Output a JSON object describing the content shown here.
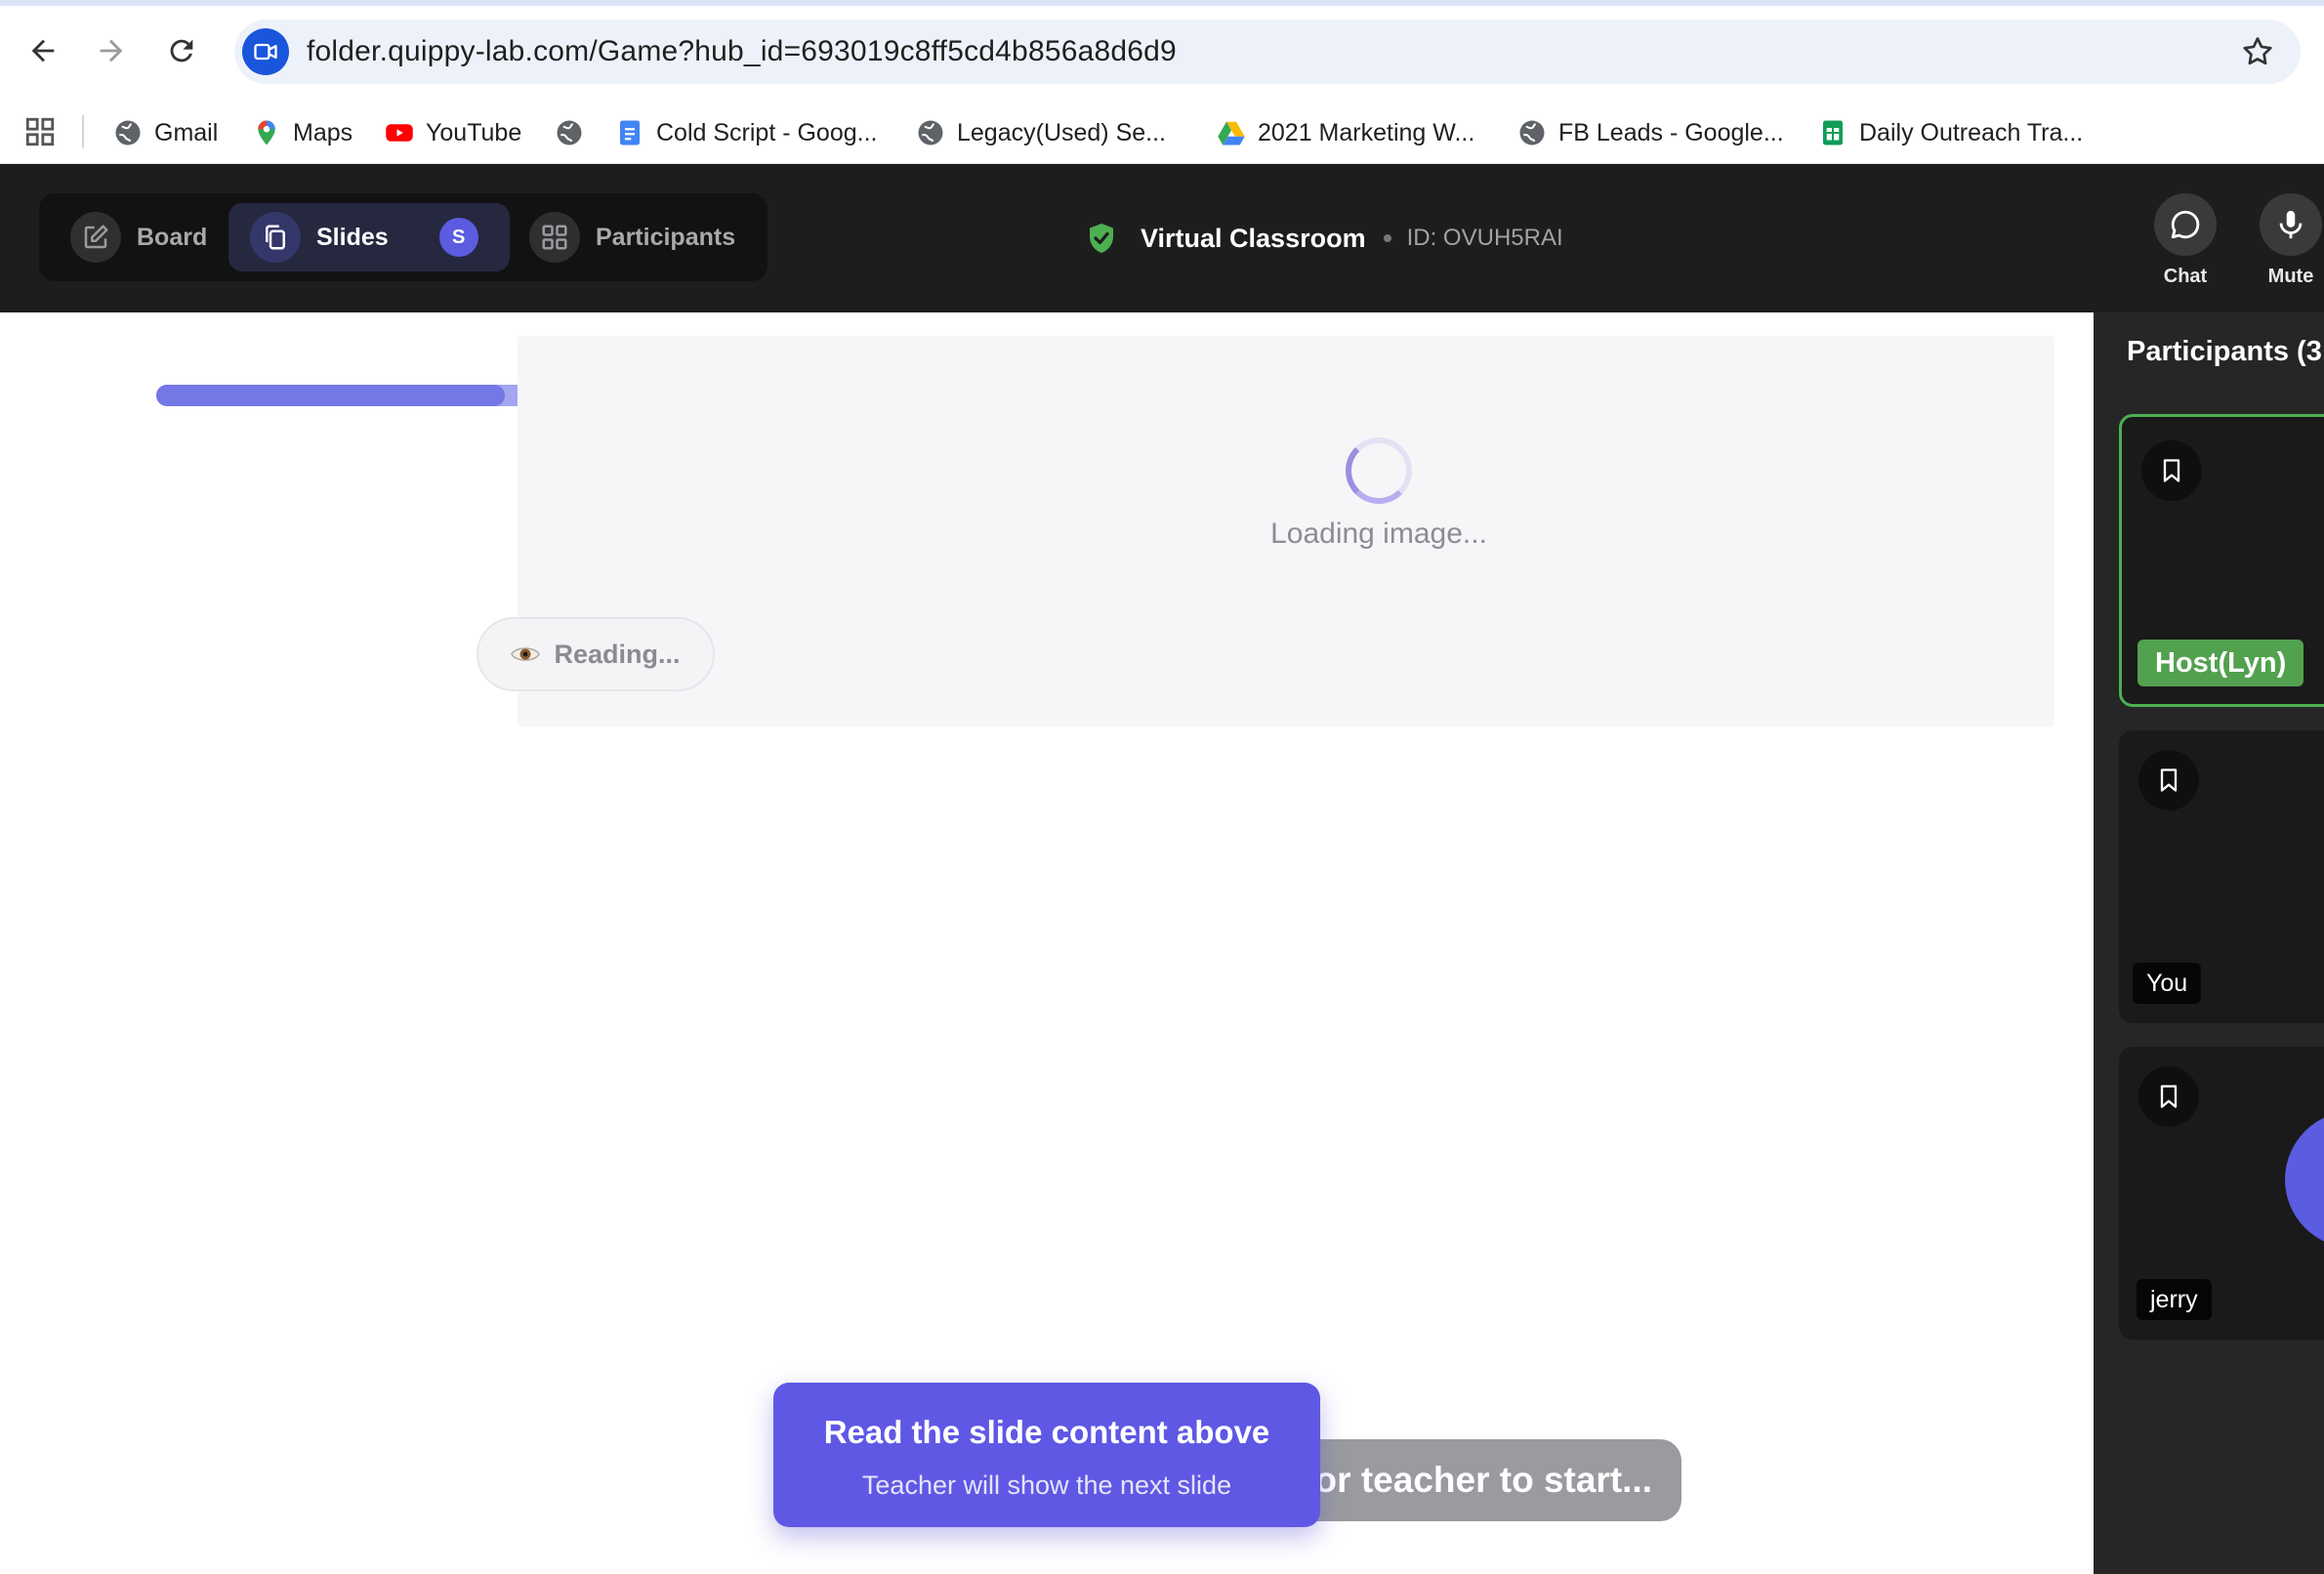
{
  "browser": {
    "url": "folder.quippy-lab.com/Game?hub_id=693019c8ff5cd4b856a8d6d9",
    "bookmarks": [
      {
        "label": "Gmail",
        "icon": "globe-icon"
      },
      {
        "label": "Maps",
        "icon": "maps-pin-icon"
      },
      {
        "label": "YouTube",
        "icon": "youtube-icon"
      },
      {
        "label": "",
        "icon": "globe-icon"
      },
      {
        "label": "Cold Script - Goog...",
        "icon": "google-docs-icon"
      },
      {
        "label": "Legacy(Used) Se...",
        "icon": "globe-icon"
      },
      {
        "label": "2021 Marketing W...",
        "icon": "google-drive-icon"
      },
      {
        "label": "FB Leads - Google...",
        "icon": "globe-icon"
      },
      {
        "label": "Daily Outreach Tra...",
        "icon": "google-sheets-icon"
      }
    ]
  },
  "header": {
    "tabs": [
      {
        "label": "Board",
        "icon": "edit-icon"
      },
      {
        "label": "Slides",
        "icon": "copy-icon",
        "badge": "S",
        "active": true
      },
      {
        "label": "Participants",
        "icon": "grid-icon"
      }
    ],
    "room_name": "Virtual Classroom",
    "room_id": "ID: OVUH5RAI",
    "controls": [
      {
        "label": "Chat",
        "icon": "chat-icon"
      },
      {
        "label": "Mute",
        "icon": "microphone-icon"
      }
    ]
  },
  "stage": {
    "progress": 0.92,
    "loading_text": "Loading image...",
    "reading_text": "Reading...",
    "waiting_text": "Waiting for teacher to start...",
    "card_title": "Read the slide content above",
    "card_subtitle": "Teacher will show the next slide"
  },
  "sidebar": {
    "title": "Participants (3",
    "participants": [
      {
        "name": "Host(Lyn)",
        "role": "host"
      },
      {
        "name": "You",
        "role": "self"
      },
      {
        "name": "jerry",
        "role": "student"
      }
    ]
  },
  "colors": {
    "accent": "#5f58e4",
    "host_green": "#52a14f",
    "header_bg": "#1d1d1d",
    "sidebar_bg": "#262626"
  }
}
